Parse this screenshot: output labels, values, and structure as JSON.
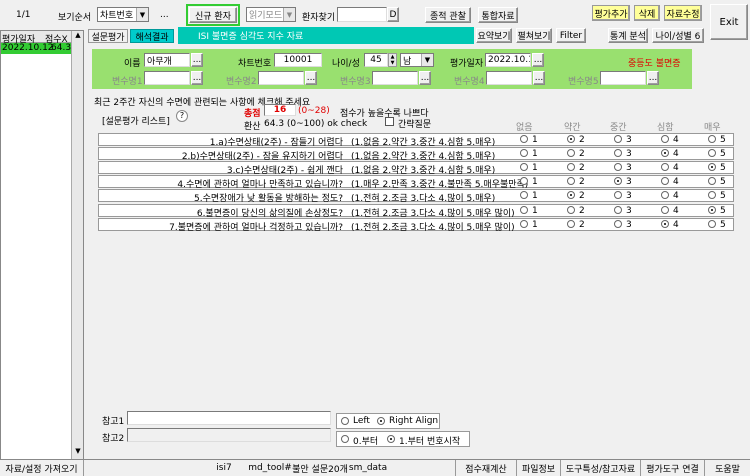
{
  "top": {
    "page_counter": "1/1",
    "view_order_label": "보기순서",
    "view_order_value": "차트번호",
    "more": "...",
    "new_patient": "신규 환자",
    "read_mode": "읽기모드",
    "patient_search_label": "환자찾기",
    "search_btn": "D",
    "integrated_view": "종적 관찰",
    "integrated_data": "통합자료",
    "add_eval": "평가추가",
    "delete": "삭제",
    "edit_data": "자료수정",
    "exit": "Exit"
  },
  "tabs": {
    "survey": "설문평가",
    "interpret": "해석결과",
    "title_box": "ISI 불면증 심각도 지수 자료",
    "summary": "요약보기",
    "fold": "펼쳐보기",
    "filter": "Filter",
    "stats": "통계 분석",
    "age_sex": "나이/성별 6"
  },
  "left_table": {
    "col1": "평가일자",
    "col2": "점수X",
    "rows": [
      {
        "date": "2022.10.12",
        "score": "64.3"
      }
    ]
  },
  "patient": {
    "name_label": "이름",
    "name_value": "아무개",
    "chart_label": "차트번호",
    "chart_value": "10001",
    "agesex_label": "나이/성",
    "age_value": "45",
    "sex_value": "남",
    "eval_date_label": "평가일자",
    "eval_date_value": "2022.10.12",
    "result": "중등도 불면증",
    "var1": "변수명1",
    "var2": "변수명2",
    "var3": "변수명3",
    "var4": "변수명4",
    "var5": "변수명5",
    "dots": "..."
  },
  "survey": {
    "instruction": "최근 2주간 자신의 수면에 관련되는 사항에 체크해 주세요",
    "list_label": "[설문평가 리스트]",
    "help": "?",
    "total_label": "총점",
    "total_value": "16",
    "total_range": "(0~28)",
    "total_note": "점수가 높을수록 나쁘다",
    "conv_label": "환산",
    "conv_value": "64.3 (0~100) ok check",
    "brief_label": "간략질문",
    "col_headers": [
      "없음",
      "약간",
      "중간",
      "심함",
      "매우"
    ],
    "questions": [
      {
        "text": "1.a)수면상태(2주) - 잠들기 어렵다",
        "opts": "(1.없음 2.약간 3.중간 4.심함 5.매우)",
        "sel": 1
      },
      {
        "text": "2.b)수면상태(2주) - 잠을 유지하기 어렵다",
        "opts": "(1.없음 2.약간 3.중간 4.심함 5.매우)",
        "sel": 3
      },
      {
        "text": "3.c)수면상태(2주) - 쉽게 깬다",
        "opts": "(1.없음 2.약간 3.중간 4.심함 5.매우)",
        "sel": 4
      },
      {
        "text": "4.수면에 관하여 얼마나 만족하고 있습니까?",
        "opts": "(1.매우 2.만족 3.중간 4.불만족 5.매우불만족)",
        "sel": 2
      },
      {
        "text": "5.수면장애가 낮 활동을 방해하는 정도?",
        "opts": "(1.전혀 2.조금 3.다소 4.많이 5.매우)",
        "sel": 1
      },
      {
        "text": "6.불면증이 당신의 삶의질에 손상정도?",
        "opts": "(1.전혀 2.조금 3.다소 4.많이 5.매우 많이)",
        "sel": 4
      },
      {
        "text": "7.불면증에 관하여 얼마나 걱정하고 있습니까?",
        "opts": "(1.전혀 2.조금 3.다소 4.많이 5.매우 많이)",
        "sel": 3
      }
    ],
    "option_nums": [
      "1",
      "2",
      "3",
      "4",
      "5"
    ]
  },
  "notes": {
    "ref1": "참고1",
    "ref2": "참고2",
    "left": "Left",
    "right": "Right Align",
    "zero": "0.부터",
    "one": "1.부터 번호시작"
  },
  "status": {
    "c0": "자료/설정 가져오기",
    "c1": "isi7",
    "c2": "md_tool#",
    "c3": "불안 설문20개",
    "c4": "sm_data",
    "c5": "점수재계산",
    "c6": "파일정보",
    "c7": "도구특성/참고자료",
    "c8": "평가도구 연결",
    "c9": "도움말"
  }
}
